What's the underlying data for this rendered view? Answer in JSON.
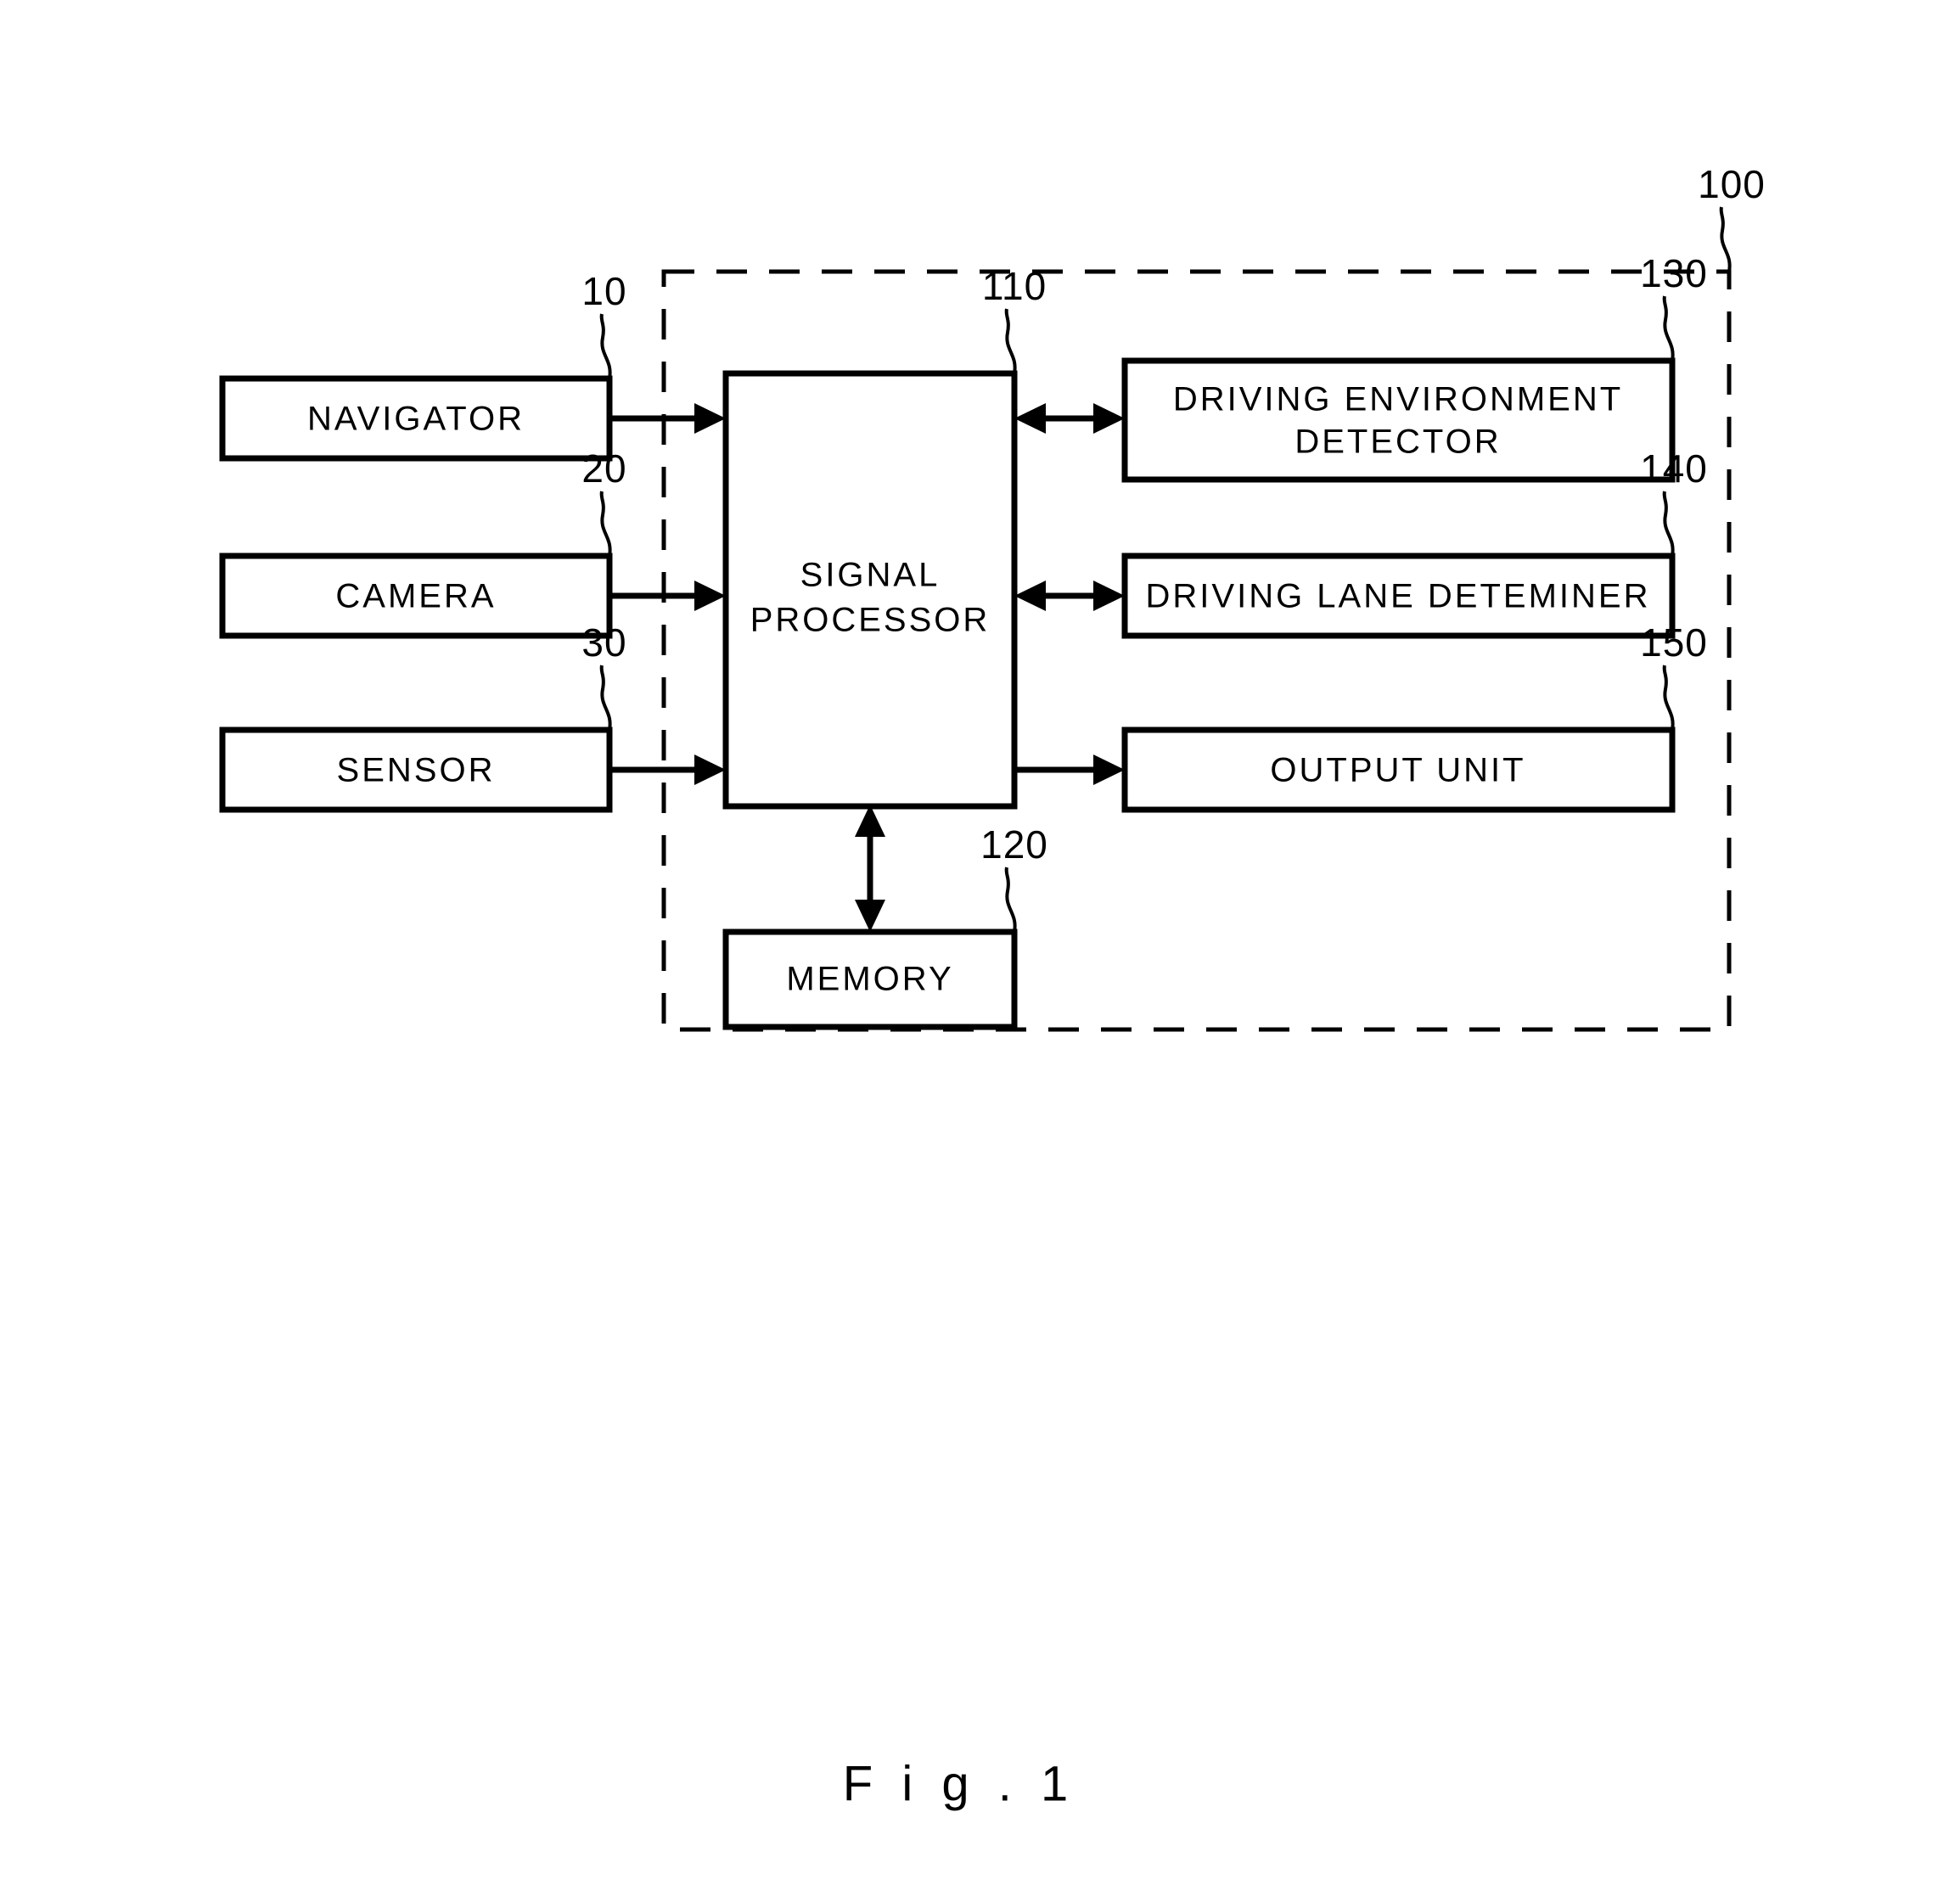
{
  "figure": {
    "caption": "F i g . 1",
    "system_ref": "100"
  },
  "boxes": [
    {
      "id": "navigator",
      "label": "NAVIGATOR",
      "ref": "10"
    },
    {
      "id": "camera",
      "label": "CAMERA",
      "ref": "20"
    },
    {
      "id": "sensor",
      "label": "SENSOR",
      "ref": "30"
    },
    {
      "id": "signal_processor",
      "label_line1": "SIGNAL",
      "label_line2": "PROCESSOR",
      "ref": "110"
    },
    {
      "id": "memory",
      "label": "MEMORY",
      "ref": "120"
    },
    {
      "id": "driving_environment_detector",
      "label_line1": "DRIVING ENVIRONMENT",
      "label_line2": "DETECTOR",
      "ref": "130"
    },
    {
      "id": "driving_lane_determiner",
      "label": "DRIVING LANE DETEMINER",
      "ref": "140"
    },
    {
      "id": "output_unit",
      "label": "OUTPUT UNIT",
      "ref": "150"
    }
  ],
  "labels": {
    "navigator": "NAVIGATOR",
    "camera": "CAMERA",
    "sensor": "SENSOR",
    "signal_processor_l1": "SIGNAL",
    "signal_processor_l2": "PROCESSOR",
    "memory": "MEMORY",
    "driving_env_l1": "DRIVING ENVIRONMENT",
    "driving_env_l2": "DETECTOR",
    "driving_lane": "DRIVING LANE DETEMINER",
    "output_unit": "OUTPUT UNIT"
  },
  "refs": {
    "navigator": "10",
    "camera": "20",
    "sensor": "30",
    "signal_processor": "110",
    "memory": "120",
    "driving_env": "130",
    "driving_lane": "140",
    "output_unit": "150",
    "system": "100"
  },
  "colors": {
    "ink": "#000000",
    "paper": "#ffffff"
  }
}
